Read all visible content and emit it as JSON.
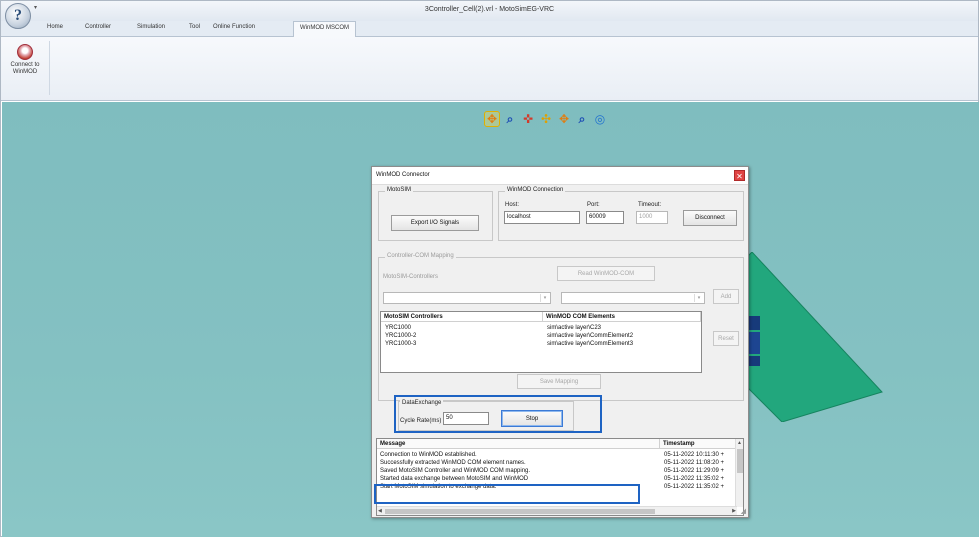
{
  "window": {
    "title": "3Controller_Cell(2).vrl - MotoSimEG-VRC",
    "logo_glyph": "?",
    "qa_glyph": "▾"
  },
  "ribbon": {
    "tabs": [
      "Home",
      "Controller",
      "Simulation",
      "Tool",
      "Online Function",
      "WinMOD MSCOM"
    ],
    "active_tab": "WinMOD MSCOM",
    "connect_button_label": "Connect to WinMOD"
  },
  "view_toolbar": {
    "icons": [
      "move-view-icon",
      "zoom-box-icon",
      "rotate-view-icon",
      "pan-icon",
      "walk-icon",
      "zoom-icon",
      "fit-view-icon"
    ],
    "glyphs": [
      "✥",
      "⌕",
      "✜",
      "✣",
      "✥",
      "⌕",
      "◎"
    ],
    "colors": [
      "#e07d10",
      "#1f4fb5",
      "#d23a2a",
      "#e0a000",
      "#e07d10",
      "#1f4fb5",
      "#1f6fd0"
    ]
  },
  "dialog": {
    "title": "WinMOD Connector",
    "close_glyph": "✕",
    "motosim_group": {
      "legend": "MotoSIM",
      "export_button": "Export I/O Signals"
    },
    "connection_group": {
      "legend": "WinMOD Connection",
      "host_label": "Host:",
      "host_value": "localhost",
      "port_label": "Port:",
      "port_value": "60009",
      "timeout_label": "Timeout:",
      "timeout_value": "1000",
      "disconnect_button": "Disconnect"
    },
    "mapping_group": {
      "legend": "Controller-COM Mapping",
      "controllers_label": "MotoSIM-Controllers",
      "read_button": "Read WinMOD-COM",
      "add_button": "Add",
      "reset_button": "Reset",
      "save_button": "Save Mapping",
      "columns": [
        "MotoSIM Controllers",
        "WinMOD COM Elements"
      ],
      "rows": [
        [
          "YRC1000",
          "sim\\active layer\\C23"
        ],
        [
          "YRC1000-2",
          "sim\\active layer\\CommElement2"
        ],
        [
          "YRC1000-3",
          "sim\\active layer\\CommElement3"
        ]
      ]
    },
    "data_exchange": {
      "legend": "DataExchange",
      "cycle_label": "Cycle Rate(ms)",
      "cycle_value": "50",
      "stop_button": "Stop"
    },
    "log": {
      "columns": [
        "Message",
        "Timestamp"
      ],
      "rows": [
        {
          "message": "Connection to WinMOD established.",
          "timestamp": "05-11-2022 10:11:30 +"
        },
        {
          "message": "Successfully extracted WinMOD COM element names.",
          "timestamp": "05-11-2022 11:08:20 +"
        },
        {
          "message": "Saved MotoSIM Controller and WinMOD COM mapping.",
          "timestamp": "05-11-2022 11:29:09 +"
        },
        {
          "message": "Started data exchange between MotoSIM and WinMOD",
          "timestamp": "05-11-2022 11:35:02 +"
        },
        {
          "message": "Start MotoSIM simulation to exchange data.",
          "timestamp": "05-11-2022 11:35:02 +"
        }
      ]
    }
  }
}
